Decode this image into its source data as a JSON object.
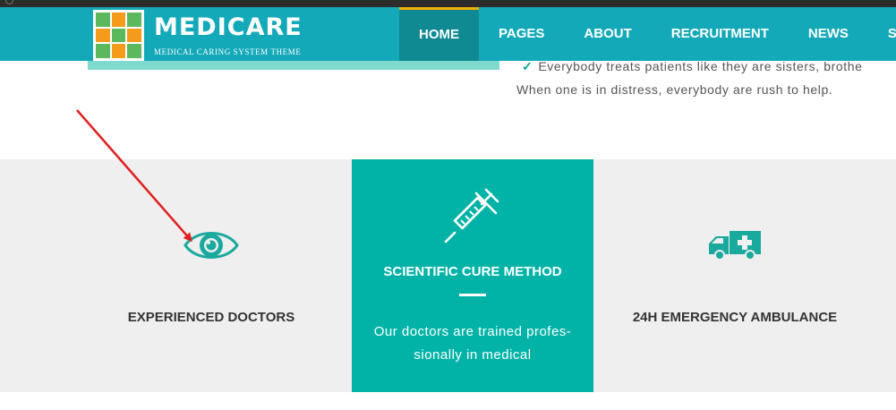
{
  "header": {
    "brand": "MEDICARE",
    "tagline": "MEDICAL CARING SYSTEM THEME",
    "nav": [
      {
        "label": "HOME"
      },
      {
        "label": "PAGES"
      },
      {
        "label": "ABOUT"
      },
      {
        "label": "RECRUITMENT"
      },
      {
        "label": "NEWS"
      },
      {
        "label": "SE"
      }
    ]
  },
  "content": {
    "line1": "Everybody treats patients like they are sisters, brothe",
    "line2": "When one is in distress, everybody are rush to help."
  },
  "features": [
    {
      "icon": "eye-icon",
      "title": "EXPERIENCED DOCTORS"
    },
    {
      "icon": "syringe-icon",
      "title": "SCIENTIFIC CURE METHOD",
      "desc_line1": "Our doctors are trained profes-",
      "desc_line2": "sionally in medical"
    },
    {
      "icon": "ambulance-icon",
      "title": "24H EMERGENCY AMBULANCE"
    }
  ],
  "colors": {
    "header": "#14a9b9",
    "nav_active": "#0f8a93",
    "accent_bar": "#f0b400",
    "teal_card": "#00b3a6",
    "icon_teal": "#1aa99d",
    "annotation_arrow": "#e02020"
  }
}
